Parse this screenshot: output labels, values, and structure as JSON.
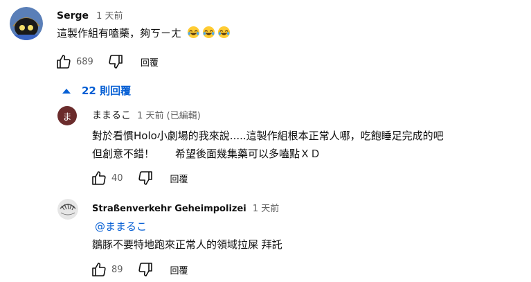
{
  "comment": {
    "author": "Serge",
    "time": "1 天前",
    "text": "這製作組有嗑藥，夠ㄎㄧㄤ",
    "emoji": [
      "😂",
      "😂",
      "😂"
    ],
    "likes": "689",
    "reply_label": "回覆",
    "replies_toggle": "22 則回覆"
  },
  "replies": [
    {
      "author": "ままるこ",
      "time": "1 天前 (已編輯)",
      "avatar_letter": "ま",
      "lines": [
        "對於看慣Holo小劇場的我來說.....這製作組根本正常人哪，吃飽睡足完成的吧",
        "但創意不錯！　　希望後面幾集藥可以多嗑點ＸＤ"
      ],
      "likes": "40",
      "reply_label": "回覆"
    },
    {
      "author": "Straßenverkehr Geheimpolizei",
      "time": "1 天前",
      "mention": "@ままるこ",
      "line": "鶵豚不要特地跑來正常人的領域拉屎 拜託",
      "likes": "89",
      "reply_label": "回覆"
    }
  ],
  "colors": {
    "link": "#065fd4",
    "avatar_ma": "#6b2c2c"
  }
}
